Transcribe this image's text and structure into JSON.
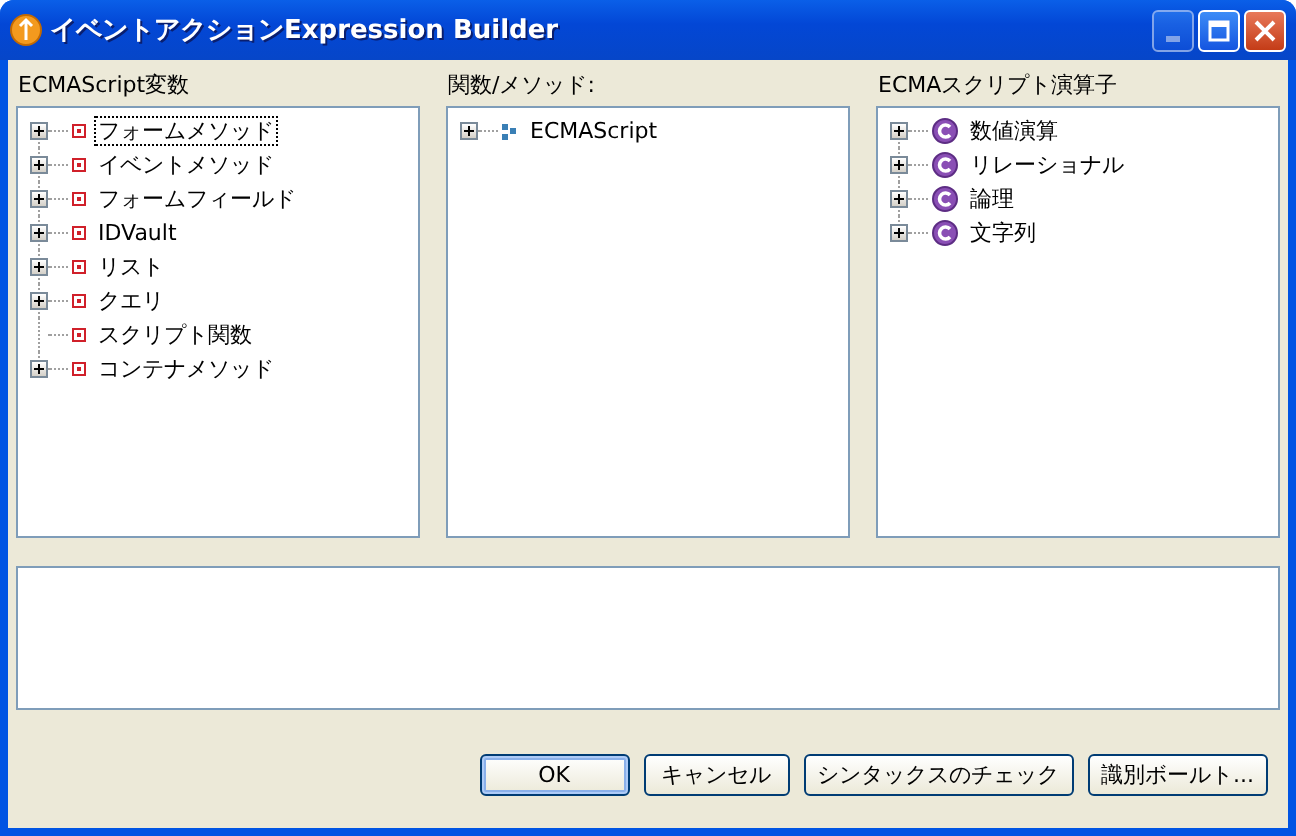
{
  "window": {
    "title": "イベントアクションExpression Builder",
    "minimize_disabled": true
  },
  "panels": [
    {
      "label": "ECMAScript変数",
      "kind": "square",
      "items": [
        {
          "text": "フォームメソッド",
          "expandable": true,
          "selected": true
        },
        {
          "text": "イベントメソッド",
          "expandable": true,
          "selected": false
        },
        {
          "text": "フォームフィールド",
          "expandable": true,
          "selected": false
        },
        {
          "text": "IDVault",
          "expandable": true,
          "selected": false
        },
        {
          "text": "リスト",
          "expandable": true,
          "selected": false
        },
        {
          "text": "クエリ",
          "expandable": true,
          "selected": false
        },
        {
          "text": "スクリプト関数",
          "expandable": false,
          "selected": false
        },
        {
          "text": "コンテナメソッド",
          "expandable": true,
          "selected": false
        }
      ]
    },
    {
      "label": "関数/メソッド:",
      "kind": "dots",
      "items": [
        {
          "text": "ECMAScript",
          "expandable": true,
          "selected": false
        }
      ]
    },
    {
      "label": "ECMAスクリプト演算子",
      "kind": "class",
      "items": [
        {
          "text": "数値演算",
          "expandable": true,
          "selected": false
        },
        {
          "text": "リレーショナル",
          "expandable": true,
          "selected": false
        },
        {
          "text": "論理",
          "expandable": true,
          "selected": false
        },
        {
          "text": "文字列",
          "expandable": true,
          "selected": false
        }
      ]
    }
  ],
  "buttons": [
    {
      "label": "OK",
      "default": true
    },
    {
      "label": "キャンセル",
      "default": false
    },
    {
      "label": "シンタックスのチェック",
      "default": false
    },
    {
      "label": "識別ボールト...",
      "default": false
    }
  ]
}
